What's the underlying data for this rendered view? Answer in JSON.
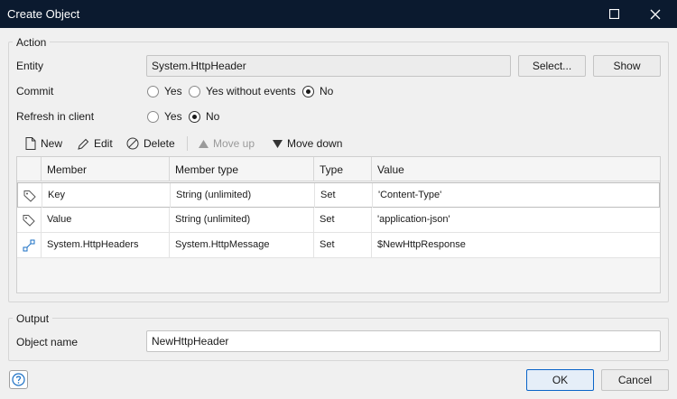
{
  "window": {
    "title": "Create Object"
  },
  "action": {
    "group_label": "Action",
    "entity_label": "Entity",
    "entity_value": "System.HttpHeader",
    "select_label": "Select...",
    "show_label": "Show",
    "commit_label": "Commit",
    "commit_options": [
      "Yes",
      "Yes without events",
      "No"
    ],
    "commit_selected": "No",
    "refresh_label": "Refresh in client",
    "refresh_options": [
      "Yes",
      "No"
    ],
    "refresh_selected": "No"
  },
  "toolbar": {
    "new_label": "New",
    "edit_label": "Edit",
    "delete_label": "Delete",
    "move_up_label": "Move up",
    "move_down_label": "Move down"
  },
  "members": {
    "columns": [
      "Member",
      "Member type",
      "Type",
      "Value"
    ],
    "rows": [
      {
        "icon": "tag-icon",
        "member": "Key",
        "member_type": "String (unlimited)",
        "type": "Set",
        "value": "'Content-Type'"
      },
      {
        "icon": "tag-icon",
        "member": "Value",
        "member_type": "String (unlimited)",
        "type": "Set",
        "value": "'application-json'"
      },
      {
        "icon": "association-icon",
        "member": "System.HttpHeaders",
        "member_type": "System.HttpMessage",
        "type": "Set",
        "value": "$NewHttpResponse"
      }
    ]
  },
  "output": {
    "group_label": "Output",
    "object_name_label": "Object name",
    "object_name_value": "NewHttpHeader"
  },
  "footer": {
    "ok_label": "OK",
    "cancel_label": "Cancel"
  },
  "colors": {
    "titlebar": "#0b1a2f",
    "primary_border": "#0a64c8"
  }
}
